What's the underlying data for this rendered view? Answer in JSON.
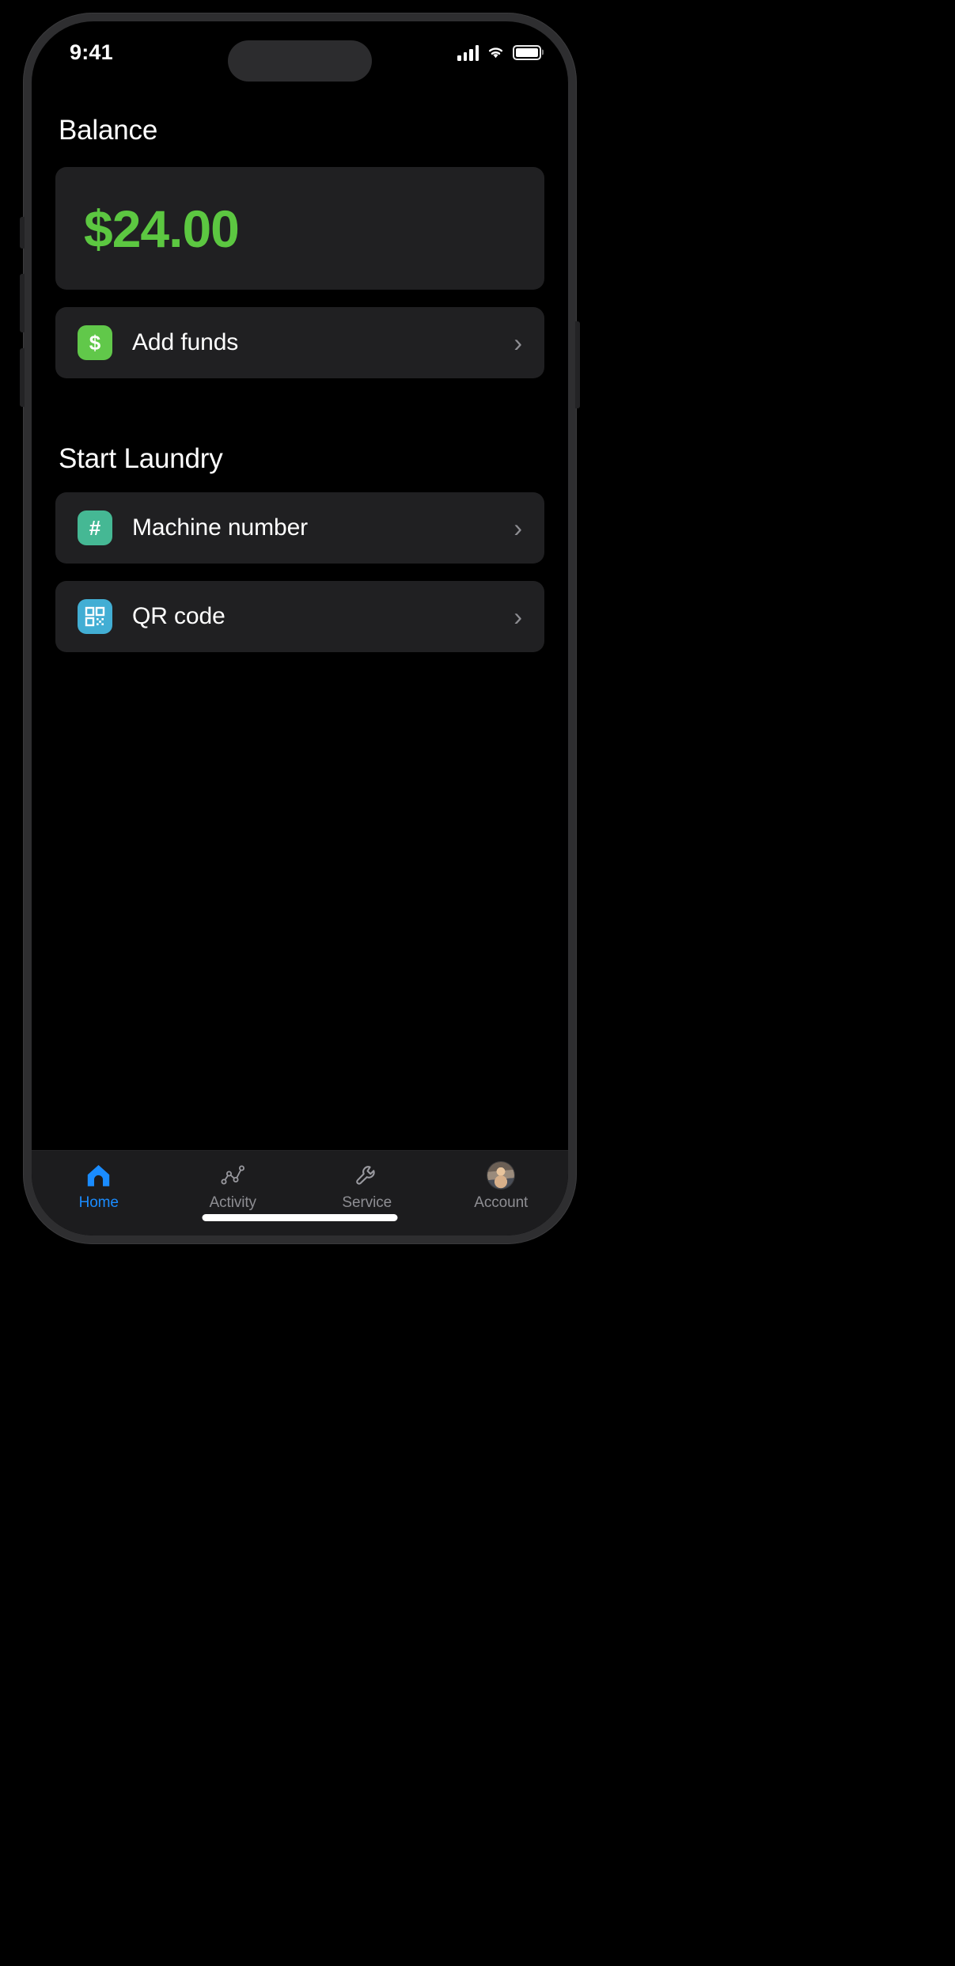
{
  "status_bar": {
    "time": "9:41",
    "signal_icon": "cellular-signal-icon",
    "wifi_icon": "wifi-icon",
    "battery_icon": "battery-icon"
  },
  "balance_section": {
    "title": "Balance",
    "amount": "$24.00",
    "amount_color": "#5cc741",
    "add_funds": {
      "label": "Add funds",
      "icon": "dollar-sign-icon",
      "icon_glyph": "$",
      "icon_color": "#61c84a",
      "chevron": "›"
    }
  },
  "laundry_section": {
    "title": "Start Laundry",
    "rows": [
      {
        "label": "Machine number",
        "icon": "hash-icon",
        "icon_glyph": "#",
        "icon_color": "#45b894",
        "chevron": "›"
      },
      {
        "label": "QR code",
        "icon": "qr-code-icon",
        "icon_glyph": "",
        "icon_color": "#42aed4",
        "chevron": "›"
      }
    ]
  },
  "tab_bar": {
    "active_color": "#1a8cff",
    "inactive_color": "#8e8e93",
    "tabs": [
      {
        "label": "Home",
        "icon": "home-icon",
        "active": true
      },
      {
        "label": "Activity",
        "icon": "activity-chart-icon",
        "active": false
      },
      {
        "label": "Service",
        "icon": "wrench-icon",
        "active": false
      },
      {
        "label": "Account",
        "icon": "avatar-photo",
        "active": false
      }
    ]
  }
}
